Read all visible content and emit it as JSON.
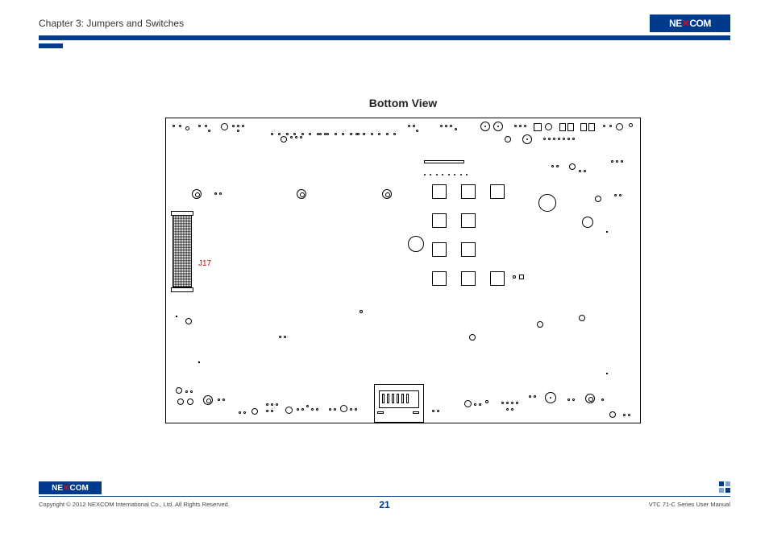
{
  "header": {
    "chapter": "Chapter 3: Jumpers and Switches",
    "logo_text": "NE COM"
  },
  "diagram": {
    "title": "Bottom View",
    "label_j17": "J17"
  },
  "footer": {
    "logo_text": "NE COM",
    "copyright": "Copyright © 2012 NEXCOM International Co., Ltd. All Rights Reserved.",
    "page": "21",
    "manual": "VTC 71-C Series User Manual"
  }
}
